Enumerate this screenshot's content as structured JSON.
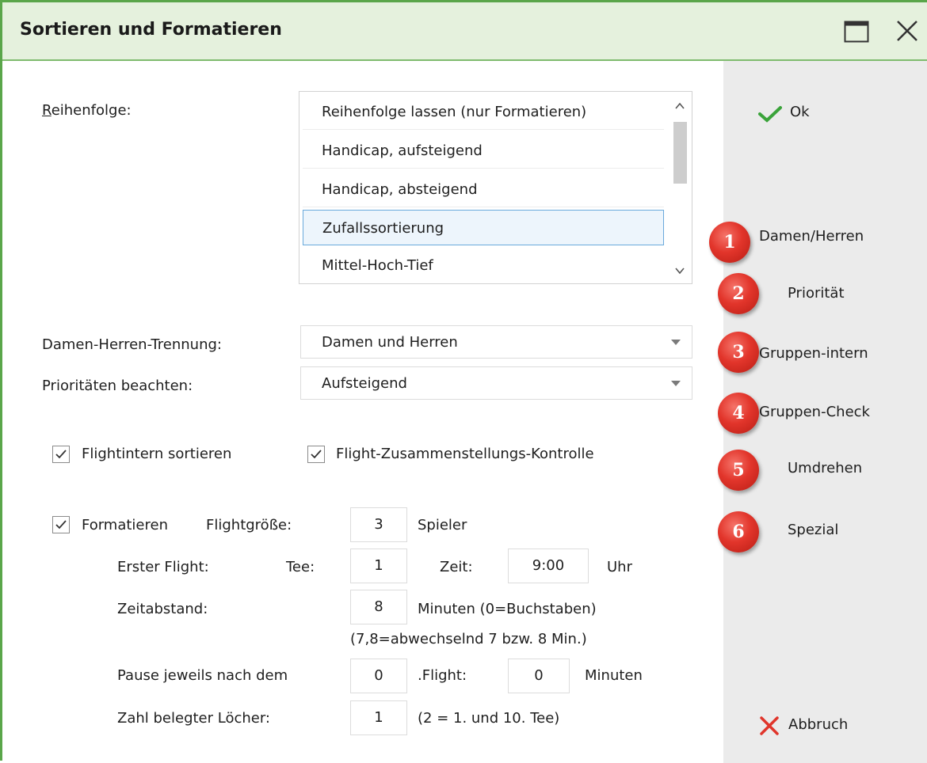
{
  "window": {
    "title": "Sortieren und Formatieren"
  },
  "labels": {
    "reihenfolge": "Reihenfolge:",
    "damen_herren_trennung": "Damen-Herren-Trennung:",
    "prioritaeten": "Prioritäten beachten:",
    "flightintern": "Flightintern sortieren",
    "flight_kontrolle": "Flight-Zusammenstellungs-Kontrolle",
    "formatieren": "Formatieren",
    "flightgroesse": "Flightgröße:",
    "spieler": "Spieler",
    "erster_flight": "Erster Flight:",
    "tee": "Tee:",
    "zeit": "Zeit:",
    "uhr": "Uhr",
    "zeitabstand": "Zeitabstand:",
    "minuten_buchstaben": "Minuten (0=Buchstaben)",
    "wechselnd_hint": "(7,8=abwechselnd 7 bzw. 8 Min.)",
    "pause": "Pause jeweils nach dem",
    "flight_suffix": ".Flight:",
    "minuten": "Minuten",
    "zahl_loecher": "Zahl belegter Löcher:",
    "loecher_hint": "(2 = 1. und 10. Tee)"
  },
  "reihenfolge_list": {
    "items": [
      "Reihenfolge lassen (nur Formatieren)",
      "Handicap, aufsteigend",
      "Handicap, absteigend",
      "Zufallssortierung",
      "Mittel-Hoch-Tief"
    ],
    "selected_index": 3
  },
  "selects": {
    "damen_herren": "Damen und Herren",
    "prioritaeten": "Aufsteigend"
  },
  "checkboxes": {
    "flightintern": true,
    "flight_kontrolle": true,
    "formatieren": true
  },
  "inputs": {
    "flightgroesse": "3",
    "tee": "1",
    "zeit": "9:00",
    "zeitabstand": "8",
    "pause_flight": "0",
    "pause_minuten": "0",
    "loecher": "1"
  },
  "side": {
    "ok": "Ok",
    "abbruch": "Abbruch",
    "buttons": [
      {
        "number": "1",
        "label": "Damen/Herren"
      },
      {
        "number": "2",
        "label": "Priorität"
      },
      {
        "number": "3",
        "label": "Gruppen-intern"
      },
      {
        "number": "4",
        "label": "Gruppen-Check"
      },
      {
        "number": "5",
        "label": "Umdrehen"
      },
      {
        "number": "6",
        "label": "Spezial"
      }
    ]
  },
  "colors": {
    "title_bg": "#e5f1dd",
    "border_green": "#5aa64a",
    "ok_check": "#3aa33a",
    "cancel_x": "#e0352b",
    "badge_red": "#e2352b",
    "selection_border": "#6aa9dc"
  },
  "icons": [
    "maximize-icon",
    "close-icon",
    "check-icon",
    "cancel-x-icon",
    "scroll-up-icon",
    "scroll-down-icon",
    "dropdown-arrow-icon"
  ]
}
